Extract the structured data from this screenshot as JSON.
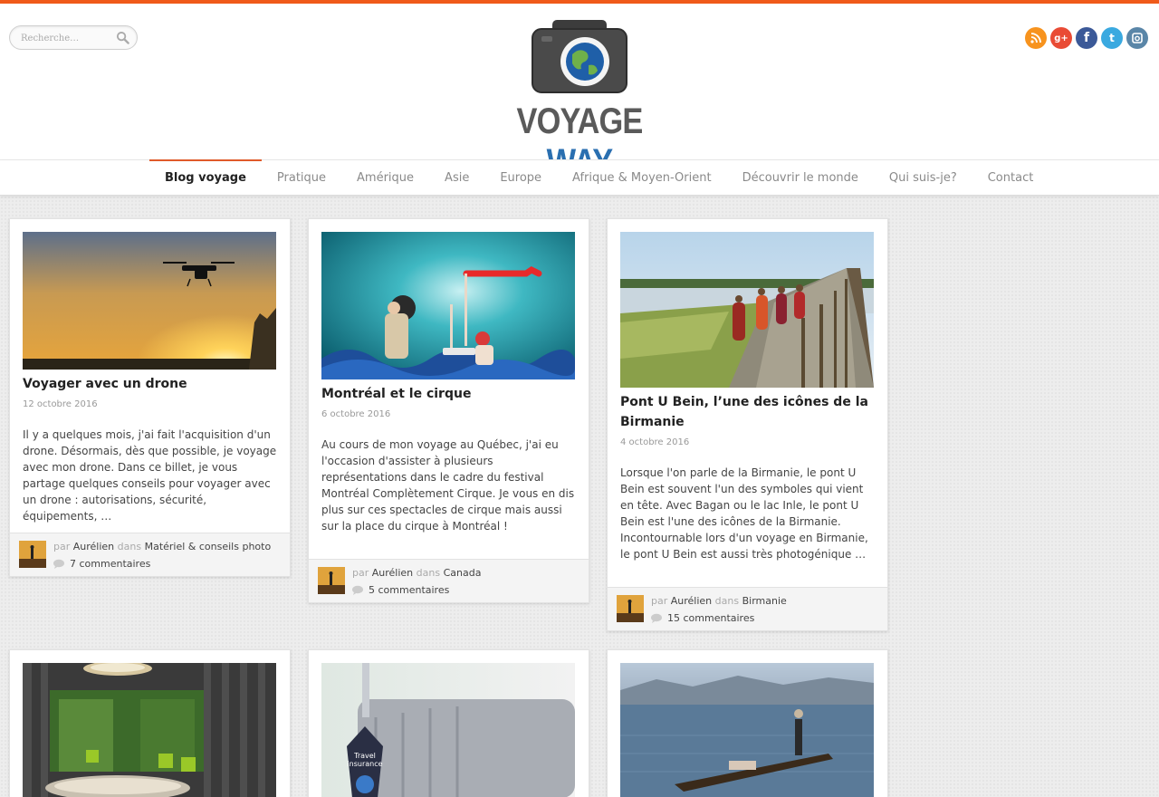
{
  "search": {
    "placeholder": "Recherche…"
  },
  "logo": {
    "word1": "VOYAGE",
    "word2": "WAY"
  },
  "social": [
    {
      "name": "rss",
      "glyph": ")"
    },
    {
      "name": "google-plus",
      "glyph": "g+"
    },
    {
      "name": "facebook",
      "glyph": "f"
    },
    {
      "name": "twitter",
      "glyph": "t"
    },
    {
      "name": "instagram",
      "glyph": "▣"
    }
  ],
  "nav": {
    "items": [
      {
        "label": "Blog voyage",
        "active": true
      },
      {
        "label": "Pratique"
      },
      {
        "label": "Amérique"
      },
      {
        "label": "Asie"
      },
      {
        "label": "Europe"
      },
      {
        "label": "Afrique & Moyen-Orient"
      },
      {
        "label": "Découvrir le monde"
      },
      {
        "label": "Qui suis-je?"
      },
      {
        "label": "Contact"
      }
    ]
  },
  "posts": [
    {
      "title": "Voyager avec un drone",
      "date": "12 octobre 2016",
      "excerpt": "Il y a quelques mois, j'ai fait l'acquisition d'un drone. Désormais, dès que possible, je voyage avec mon drone. Dans ce billet, je vous partage quelques conseils pour voyager avec un drone : autorisations, sécurité, équipements, …",
      "by_prefix": "par",
      "author": "Aurélien",
      "in_word": "dans",
      "category": "Matériel & conseils photo",
      "comments": "7 commentaires"
    },
    {
      "title": "Montréal et le cirque",
      "date": "6 octobre 2016",
      "excerpt": "Au cours de mon voyage au Québec, j'ai eu l'occasion d'assister à plusieurs représentations dans le cadre du festival Montréal Complètement Cirque. Je vous en dis plus sur ces spectacles de cirque mais aussi sur la place du cirque à Montréal !",
      "by_prefix": "par",
      "author": "Aurélien",
      "in_word": "dans",
      "category": "Canada",
      "comments": "5 commentaires"
    },
    {
      "title": "Pont U Bein, l’une des icônes de la Birmanie",
      "date": "4 octobre 2016",
      "excerpt": "Lorsque l'on parle de la Birmanie, le pont U Bein est souvent l'un des symboles qui vient en tête. Avec Bagan ou le lac Inle, le pont U Bein est l'une des icônes de la Birmanie. Incontournable lors d'un voyage en Birmanie, le pont U Bein est aussi très photogénique …",
      "by_prefix": "par",
      "author": "Aurélien",
      "in_word": "dans",
      "category": "Birmanie",
      "comments": "15 commentaires"
    }
  ],
  "lower_posts": [
    {
      "image_label": ""
    },
    {
      "image_label": "Travel insurance"
    },
    {
      "image_label": ""
    }
  ]
}
